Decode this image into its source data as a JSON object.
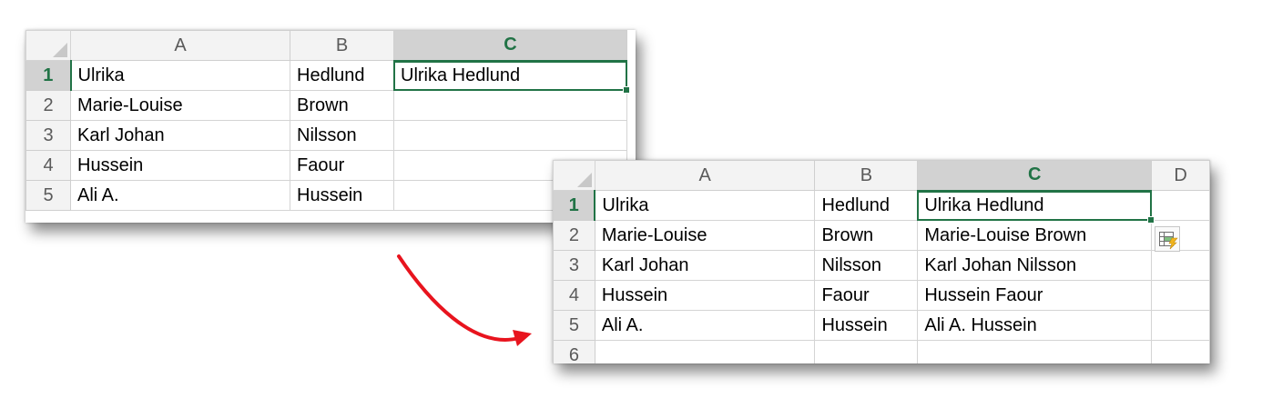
{
  "before": {
    "columns": [
      "A",
      "B",
      "C"
    ],
    "active_column": "C",
    "selected_cell": "C1",
    "rows": [
      {
        "num": "1",
        "a": "Ulrika",
        "b": "Hedlund",
        "c": "Ulrika Hedlund"
      },
      {
        "num": "2",
        "a": "Marie-Louise",
        "b": "Brown",
        "c": ""
      },
      {
        "num": "3",
        "a": "Karl Johan",
        "b": "Nilsson",
        "c": ""
      },
      {
        "num": "4",
        "a": "Hussein",
        "b": "Faour",
        "c": ""
      },
      {
        "num": "5",
        "a": "Ali A.",
        "b": "Hussein",
        "c": ""
      }
    ]
  },
  "after": {
    "columns": [
      "A",
      "B",
      "C",
      "D"
    ],
    "active_column": "C",
    "selected_cell": "C1",
    "rows": [
      {
        "num": "1",
        "a": "Ulrika",
        "b": "Hedlund",
        "c": "Ulrika Hedlund"
      },
      {
        "num": "2",
        "a": "Marie-Louise",
        "b": "Brown",
        "c": "Marie-Louise Brown"
      },
      {
        "num": "3",
        "a": "Karl Johan",
        "b": "Nilsson",
        "c": "Karl Johan Nilsson"
      },
      {
        "num": "4",
        "a": "Hussein",
        "b": "Faour",
        "c": "Hussein Faour"
      },
      {
        "num": "5",
        "a": "Ali A.",
        "b": "Hussein",
        "c": "Ali A. Hussein"
      },
      {
        "num": "6",
        "a": "",
        "b": "",
        "c": ""
      }
    ]
  },
  "icons": {
    "flash_fill_options": "flash-fill-options-icon",
    "transition_arrow": "curved-arrow-icon"
  },
  "colors": {
    "excel_green": "#217346",
    "arrow_red": "#e8141e",
    "header_bg": "#f3f3f3",
    "active_header_bg": "#d2d2d2",
    "gridline": "#d4d4d4"
  }
}
